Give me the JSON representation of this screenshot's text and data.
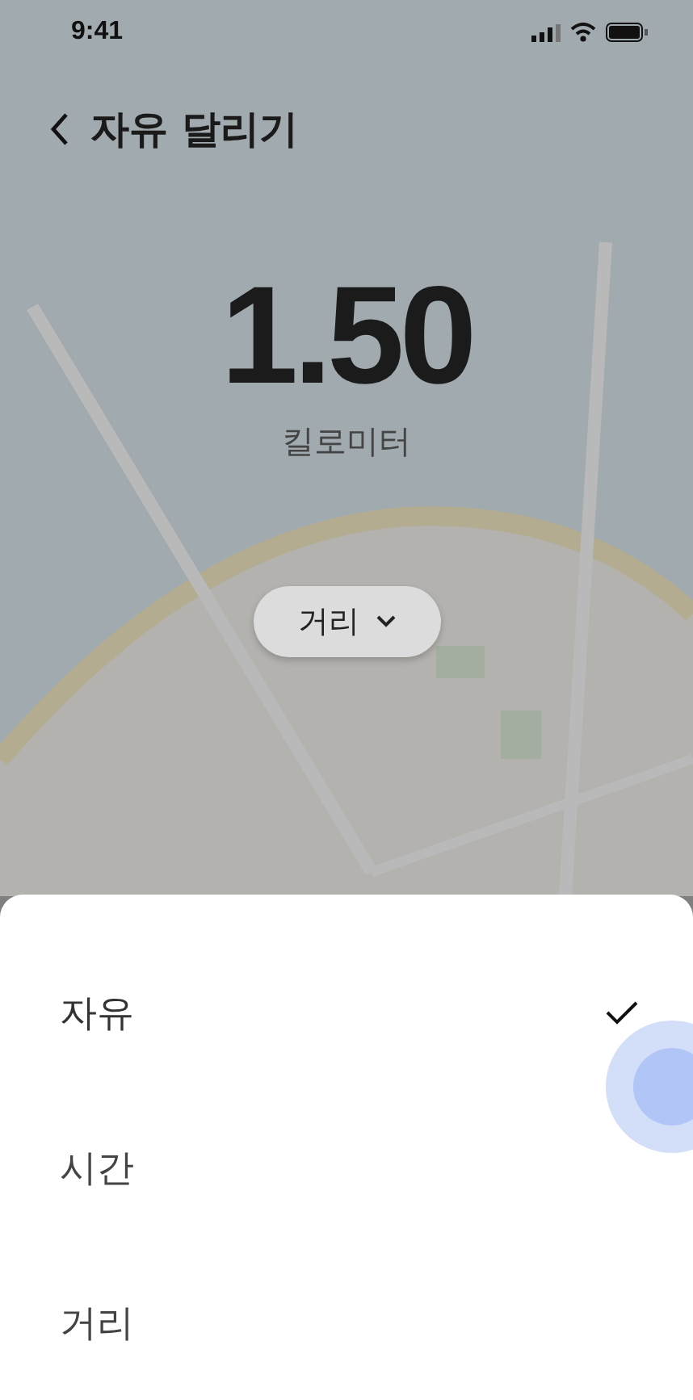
{
  "status_bar": {
    "time": "9:41"
  },
  "header": {
    "title": "자유 달리기"
  },
  "metric": {
    "value": "1.50",
    "unit": "킬로미터"
  },
  "mode_button": {
    "label": "거리"
  },
  "sheet": {
    "options": [
      {
        "label": "자유",
        "selected": true
      },
      {
        "label": "시간",
        "selected": false
      },
      {
        "label": "거리",
        "selected": false
      }
    ]
  }
}
